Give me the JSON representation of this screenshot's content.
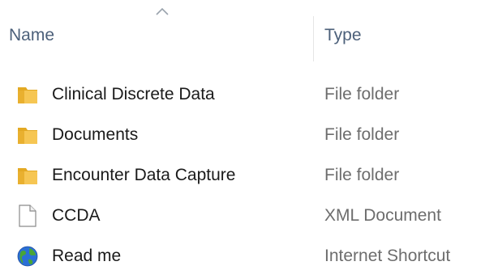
{
  "columns": {
    "name": "Name",
    "type": "Type",
    "sort_icon": "chevron-up-icon"
  },
  "colors": {
    "folder": "#f2bf4a",
    "header_text": "#4c607a",
    "type_text": "#6d6d6d"
  },
  "rows": [
    {
      "name": "Clinical Discrete Data",
      "type": "File folder",
      "icon": "folder-icon"
    },
    {
      "name": "Documents",
      "type": "File folder",
      "icon": "folder-icon"
    },
    {
      "name": "Encounter Data Capture",
      "type": "File folder",
      "icon": "folder-icon"
    },
    {
      "name": "CCDA",
      "type": "XML Document",
      "icon": "document-icon"
    },
    {
      "name": "Read me",
      "type": "Internet Shortcut",
      "icon": "globe-icon"
    }
  ]
}
